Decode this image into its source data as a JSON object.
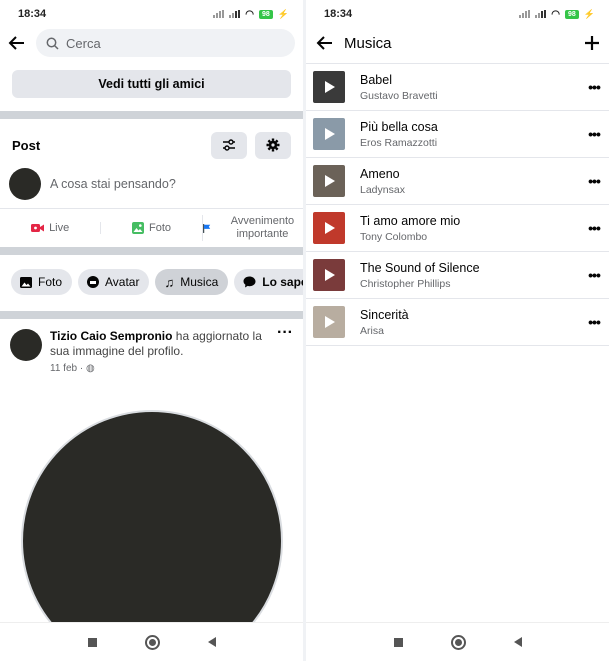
{
  "status_bar": {
    "time": "18:34",
    "battery": "98"
  },
  "left": {
    "search_placeholder": "Cerca",
    "see_all_friends": "Vedi tutti gli amici",
    "post_section_title": "Post",
    "composer_placeholder": "A cosa stai pensando?",
    "actions": [
      {
        "label": "Live",
        "icon": "live-icon",
        "color": "#e42645"
      },
      {
        "label": "Foto",
        "icon": "photo-icon",
        "color": "#45bd62"
      },
      {
        "label": "Avvenimento importante",
        "icon": "flag-icon",
        "color": "#1877f2"
      }
    ],
    "chips": [
      {
        "label": "Foto",
        "icon": "photo-icon"
      },
      {
        "label": "Avatar",
        "icon": "avatar-icon"
      },
      {
        "label": "Musica",
        "icon": "music-note-icon",
        "active": true
      },
      {
        "label": "Lo sapev",
        "icon": "chat-bubble-icon"
      }
    ],
    "feed_post": {
      "author": "Tizio Caio Sempronio",
      "action": " ha aggiornato la sua immagine del profilo.",
      "date": "11 feb",
      "privacy_icon": "globe-icon"
    }
  },
  "right": {
    "title": "Musica",
    "songs": [
      {
        "title": "Babel",
        "artist": "Gustavo Bravetti",
        "thumb_color": "#3a3a3a"
      },
      {
        "title": "Più bella cosa",
        "artist": "Eros Ramazzotti",
        "thumb_color": "#8a9aa8"
      },
      {
        "title": "Ameno",
        "artist": "Ladynsax",
        "thumb_color": "#6b6258"
      },
      {
        "title": "Ti amo amore mio",
        "artist": "Tony Colombo",
        "thumb_color": "#c0392b"
      },
      {
        "title": "The Sound of Silence",
        "artist": "Christopher Phillips",
        "thumb_color": "#7a3b3b"
      },
      {
        "title": "Sincerità",
        "artist": "Arisa",
        "thumb_color": "#b8ada0"
      }
    ]
  }
}
